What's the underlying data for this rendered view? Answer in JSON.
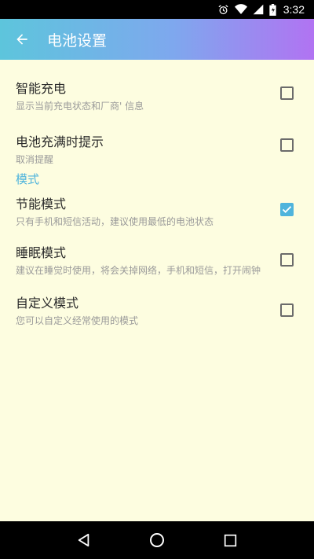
{
  "status_bar": {
    "time": "3:32",
    "icons": [
      "alarm-icon",
      "wifi-icon",
      "signal-icon",
      "battery-icon"
    ]
  },
  "app_bar": {
    "title": "电池设置",
    "back_icon": "arrow-back-icon",
    "gradient_colors": [
      "#5dc5dc",
      "#b173f2"
    ]
  },
  "settings": {
    "smart_charge": {
      "title": "智能充电",
      "desc": "显示当前充电状态和厂商' 信息",
      "checked": false
    },
    "full_charge_alert": {
      "title": "电池充满时提示",
      "desc": "取消提醒",
      "checked": false
    },
    "modes_header": "模式",
    "power_save": {
      "title": "节能模式",
      "desc": "只有手机和短信活动，建议使用最低的电池状态",
      "checked": true
    },
    "sleep_mode": {
      "title": "睡眠模式",
      "desc": "建议在睡觉时使用，将会关掉网络，手机和短信，打开闹钟",
      "checked": false
    },
    "custom_mode": {
      "title": "自定义模式",
      "desc": "您可以自定义经常使用的模式",
      "checked": false
    }
  },
  "colors": {
    "accent": "#4fb4dc",
    "background": "#fdfde0"
  },
  "nav_bar": {
    "icons": [
      "back-triangle-icon",
      "home-circle-icon",
      "recents-square-icon"
    ]
  }
}
